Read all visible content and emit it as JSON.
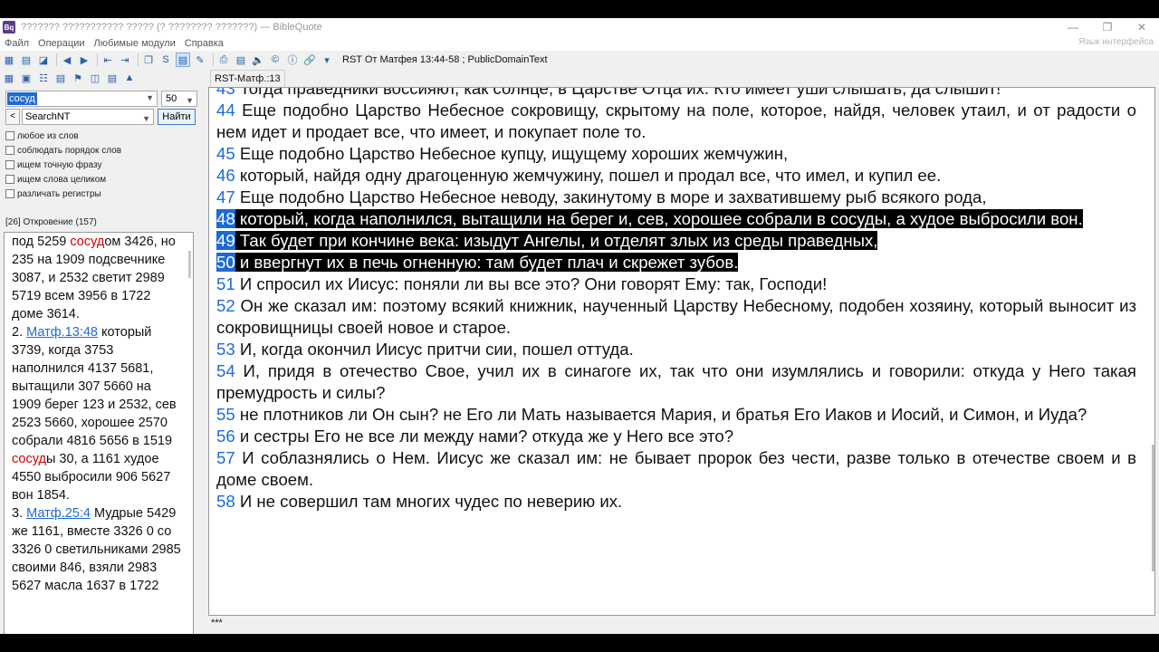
{
  "title_bar": {
    "icon_label": "Bq",
    "title": "??????? ??????????? ????? (? ???????? ???????) — BibleQuote"
  },
  "menu": {
    "items": [
      "Файл",
      "Операции",
      "Любимые модули",
      "Справка"
    ],
    "interface_language": "Язык интерфейса"
  },
  "toolbar": {
    "reference": "RST От Матфея 13:44-58 ; PublicDomainText"
  },
  "tabs": {
    "active": "RST-Матф.:13",
    "bottom": "***"
  },
  "search": {
    "query": "сосуд",
    "count": "50",
    "module": "SearchNT",
    "find_button": "Найти",
    "options": [
      "любое из слов",
      "соблюдать порядок слов",
      "ищем точную фразу",
      "ищем слова целиком",
      "различать регистры"
    ],
    "status": "[26] Откровение (157)"
  },
  "results": [
    {
      "parts": [
        {
          "t": "под 5259 "
        },
        {
          "t": "сосуд",
          "hl": true
        },
        {
          "t": "ом 3426, но 235 на 1909 подсвечнике 3087, и 2532 светит 2989 5719 всем 3956 в 1722 доме 3614."
        }
      ]
    },
    {
      "parts": [
        {
          "t": "2. "
        },
        {
          "t": "Матф.13:48",
          "link": true
        },
        {
          "t": " который 3739, когда 3753 наполнился 4137 5681, вытащили 307 5660 на 1909 берег 123 и 2532, сев 2523 5660, хорошее 2570 собрали 4816 5656 в 1519 "
        },
        {
          "t": "сосуд",
          "hl": true
        },
        {
          "t": "ы 30, а 1161 худое 4550 выбросили 906 5627 вон 1854."
        }
      ]
    },
    {
      "parts": [
        {
          "t": "3. "
        },
        {
          "t": "Матф.25:4",
          "link": true
        },
        {
          "t": " Мудрые 5429 же 1161, вместе 3326 0 со 3326 0 светильниками 2985 своими 846, взяли 2983 5627 масла 1637 в 1722"
        }
      ]
    }
  ],
  "verses": [
    {
      "num": "43",
      "text": "Тогда праведники воссияют, как солнце, в Царстве Отца их. Кто имеет уши слышать, да слышит!"
    },
    {
      "num": "44",
      "text": "Еще подобно Царство Небесное сокровищу, скрытому на поле, которое, найдя, человек утаил, и от радости о нем идет и продает все, что имеет, и покупает поле то."
    },
    {
      "num": "45",
      "text": "Еще подобно Царство Небесное купцу, ищущему хороших жемчужин,"
    },
    {
      "num": "46",
      "text": "который, найдя одну драгоценную жемчужину, пошел и продал все, что имел, и купил ее."
    },
    {
      "num": "47",
      "text": "Еще подобно Царство Небесное неводу, закинутому в море и захватившему рыб всякого рода,"
    },
    {
      "num": "48",
      "text": "который, когда наполнился, вытащили на берег и, сев, хорошее собрали в сосуды, а худое выбросили вон.",
      "selected": true
    },
    {
      "num": "49",
      "text": "Так будет при кончине века: изыдут Ангелы, и отделят злых из среды праведных,",
      "selected": true
    },
    {
      "num": "50",
      "text": "и ввергнут их в печь огненную: там будет плач и скрежет зубов.",
      "selected": true
    },
    {
      "num": "51",
      "text": "И спросил их Иисус: поняли ли вы все это? Они говорят Ему: так, Господи!"
    },
    {
      "num": "52",
      "text": "Он же сказал им: поэтому всякий книжник, наученный Царству Небесному, подобен хозяину, который выносит из сокровищницы своей новое и старое."
    },
    {
      "num": "53",
      "text": "И, когда окончил Иисус притчи сии, пошел оттуда."
    },
    {
      "num": "54",
      "text": "И, придя в отечество Свое, учил их в синагоге их, так что они изумлялись и говорили: откуда у Него такая премудрость и силы?"
    },
    {
      "num": "55",
      "text": "не плотников ли Он сын? не Его ли Мать называется Мария, и братья Его Иаков и Иосий, и Симон, и Иуда?"
    },
    {
      "num": "56",
      "text": "и сестры Его не все ли между нами? откуда же у Него все это?"
    },
    {
      "num": "57",
      "text": "И соблазнялись о Нем. Иисус же сказал им: не бывает пророк без чести, разве только в отечестве своем и в доме своем."
    },
    {
      "num": "58",
      "text": "И не совершил там многих чудес по неверию их."
    }
  ],
  "colors": {
    "verse_number": "#1c6bd6",
    "search_hit": "#d00000",
    "selection_bg": "#000000"
  }
}
